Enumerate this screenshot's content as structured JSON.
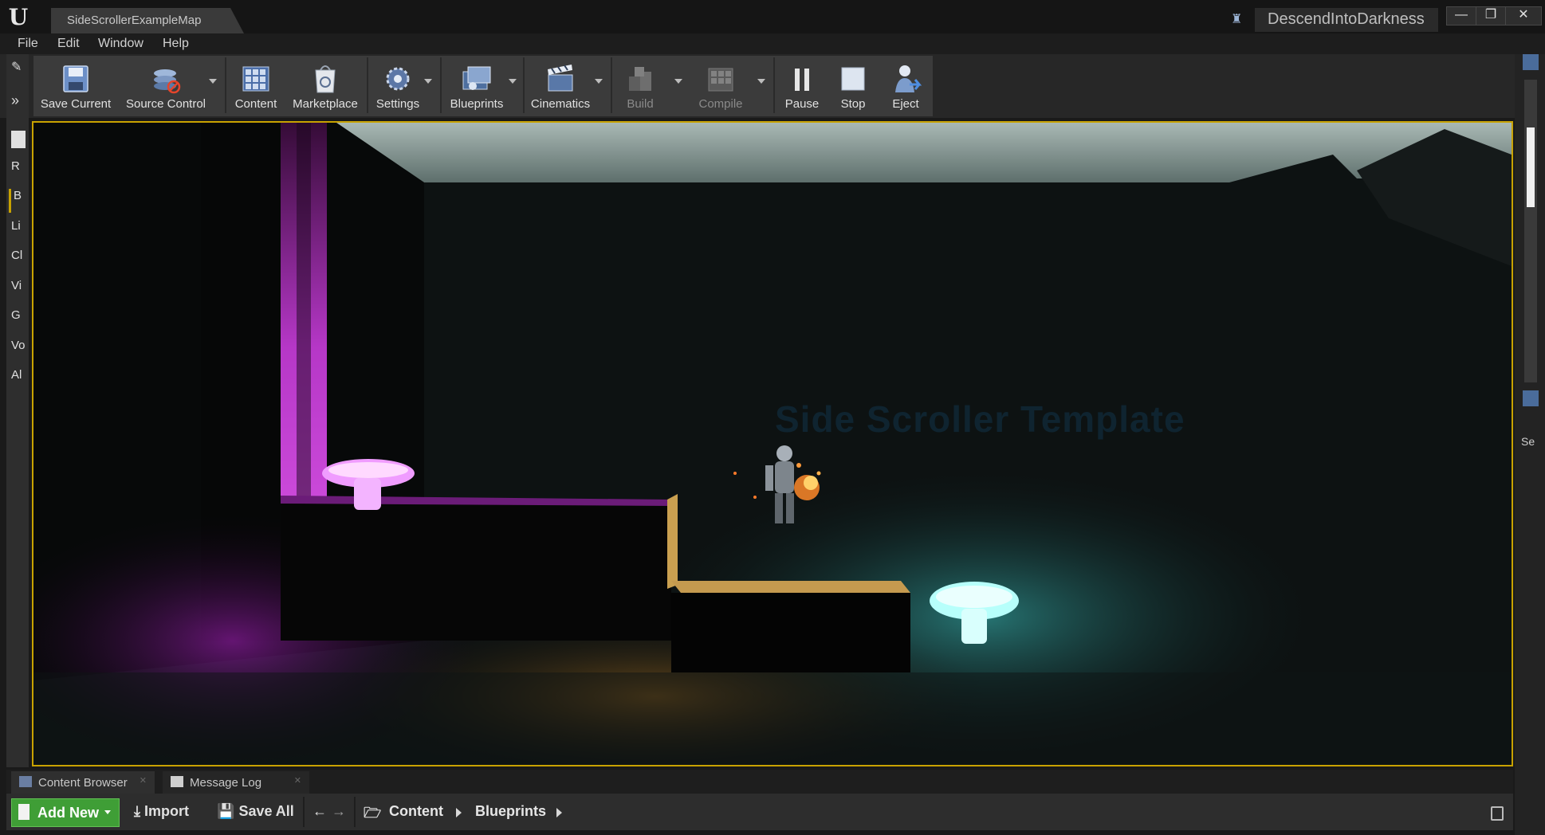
{
  "window": {
    "tab_title": "SideScrollerExampleMap",
    "project_name": "DescendIntoDarkness",
    "minimize": "—",
    "maximize": "❐",
    "close": "✕"
  },
  "menu": [
    "File",
    "Edit",
    "Window",
    "Help"
  ],
  "toolbar": {
    "save_current": "Save Current",
    "source_control": "Source Control",
    "content": "Content",
    "marketplace": "Marketplace",
    "settings": "Settings",
    "blueprints": "Blueprints",
    "cinematics": "Cinematics",
    "build": "Build",
    "compile": "Compile",
    "pause": "Pause",
    "stop": "Stop",
    "eject": "Eject"
  },
  "left_tabs": [
    "R",
    "B",
    "Li",
    "Cl",
    "Vi",
    "G",
    "Vo",
    "Al"
  ],
  "viewport": {
    "watermark": "Side Scroller Template"
  },
  "right_panel": {
    "label": "Se"
  },
  "bottom_tabs": [
    "Content Browser",
    "Message Log"
  ],
  "content_browser": {
    "add_new": "Add New",
    "import": "Import",
    "save_all": "Save All",
    "breadcrumb": [
      "Content",
      "Blueprints"
    ]
  },
  "colors": {
    "viewport_border": "#c8a200",
    "add_new_green": "#3f9e36",
    "magenta_glow": "#e040ff",
    "cyan_glow": "#7ff7f4"
  }
}
